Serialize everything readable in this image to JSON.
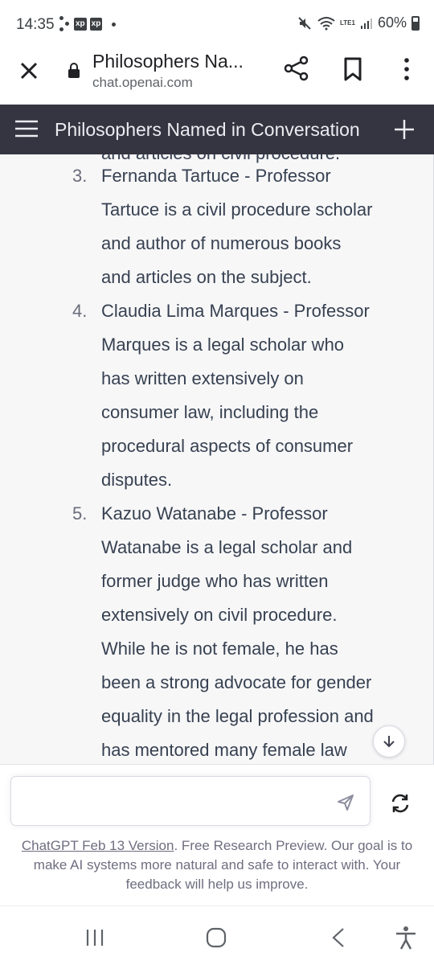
{
  "status_bar": {
    "time": "14:35",
    "badge1": "xp",
    "badge2": "xp",
    "signal_label": "LTE1",
    "battery": "60%"
  },
  "browser": {
    "title": "Philosophers Na...",
    "url": "chat.openai.com",
    "icons": [
      "close-icon",
      "lock-icon",
      "share-icon",
      "bookmark-icon",
      "more-icon"
    ]
  },
  "app_header": {
    "title": "Philosophers Named in Conversation",
    "icons": [
      "menu-icon",
      "plus-icon"
    ]
  },
  "conversation": {
    "clipped_line": "and articles on civil procedure.",
    "items": [
      {
        "number": "3.",
        "lines": [
          "Fernanda Tartuce - Professor",
          "Tartuce is a civil procedure scholar",
          "and author of numerous books",
          "and articles on the subject."
        ]
      },
      {
        "number": "4.",
        "lines": [
          "Claudia Lima Marques - Professor",
          "Marques is a legal scholar who",
          "has written extensively on",
          "consumer law, including the",
          "procedural aspects of consumer",
          "disputes."
        ]
      },
      {
        "number": "5.",
        "lines": [
          "Kazuo Watanabe - Professor",
          "Watanabe is a legal scholar and",
          "former judge who has written",
          "extensively on civil procedure.",
          "While he is not female, he has",
          "been a strong advocate for gender",
          "equality in the legal profession and",
          "has mentored many female law"
        ]
      }
    ]
  },
  "input": {
    "placeholder": "",
    "value": ""
  },
  "footer": {
    "link_text": "ChatGPT Feb 13 Version",
    "text": ". Free Research Preview. Our goal is to make AI systems more natural and safe to interact with. Your feedback will help us improve."
  },
  "colors": {
    "header_bg": "#343541",
    "content_bg": "#f7f7f8",
    "text": "#374151"
  }
}
